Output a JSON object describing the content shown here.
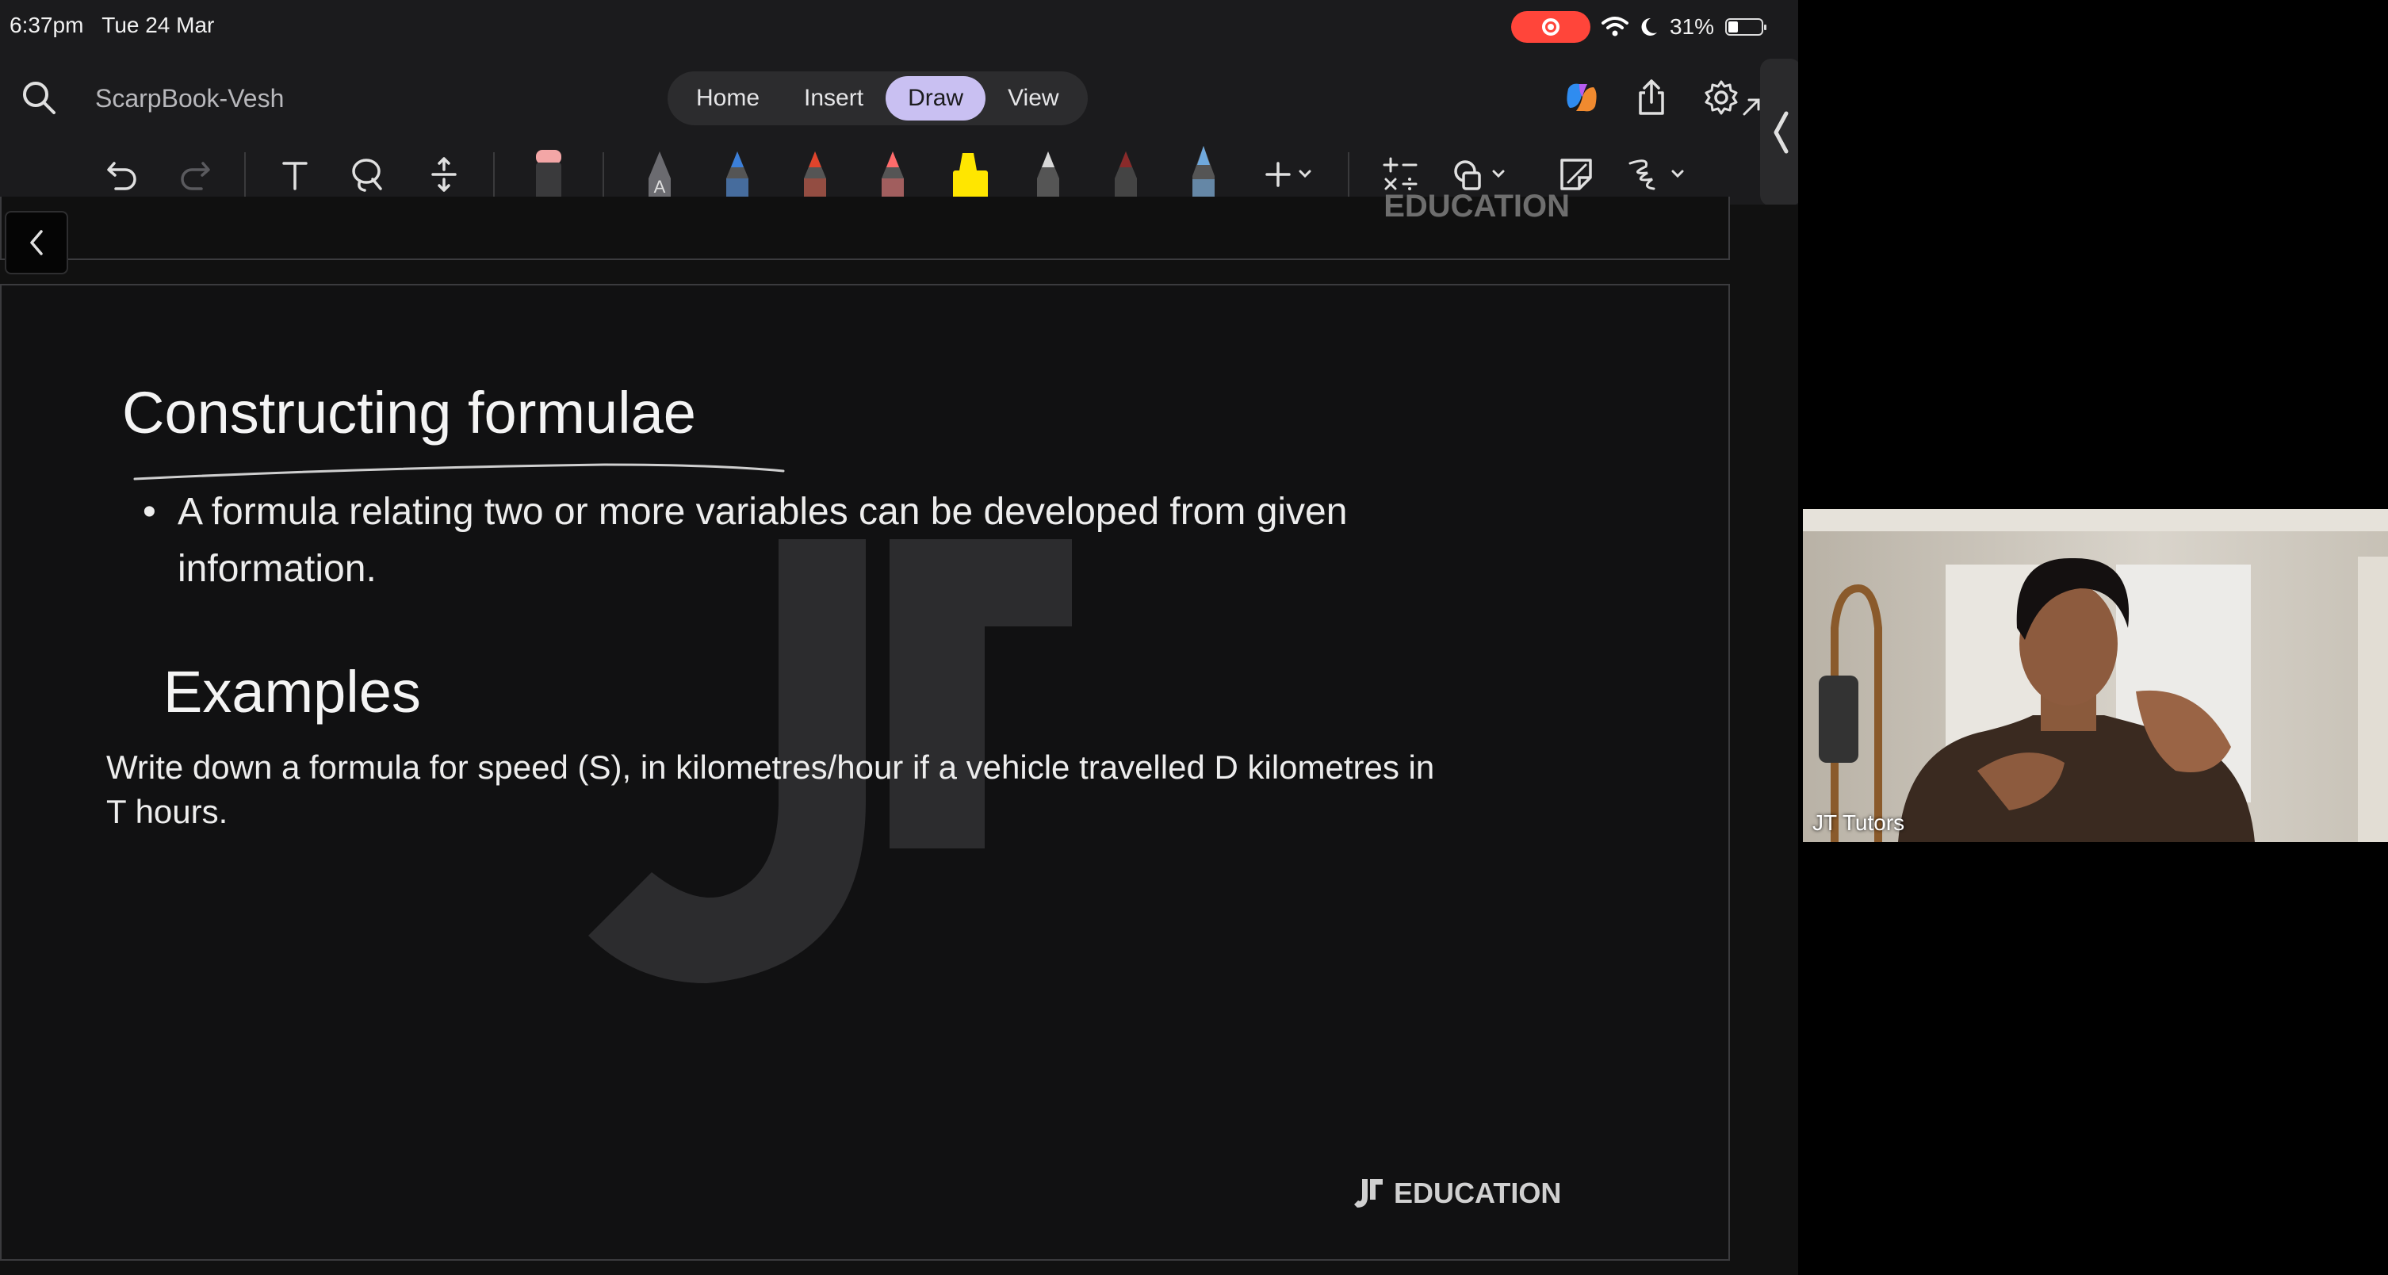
{
  "status_bar": {
    "time": "6:37pm",
    "date": "Tue 24 Mar",
    "battery": "31%"
  },
  "topbar": {
    "document_title": "ScarpBook-Vesh",
    "tabs": [
      {
        "label": "Home",
        "active": false
      },
      {
        "label": "Insert",
        "active": false
      },
      {
        "label": "Draw",
        "active": true
      },
      {
        "label": "View",
        "active": false
      }
    ]
  },
  "toolbar": {
    "tools": [
      "undo-icon",
      "redo-icon",
      "text-icon",
      "lasso-icon",
      "add-space-icon",
      "eraser-icon"
    ],
    "pens": [
      {
        "name": "pen-ink-to-text",
        "color": "#8e8e93",
        "label": "A"
      },
      {
        "name": "pen-blue",
        "color": "#3b7fd9"
      },
      {
        "name": "pen-red",
        "color": "#e0442c"
      },
      {
        "name": "pen-pink",
        "color": "#ff6b6b"
      },
      {
        "name": "highlighter-yellow",
        "color": "#ffe600"
      },
      {
        "name": "pen-white",
        "color": "#d8d8d8"
      },
      {
        "name": "pen-dark-red",
        "color": "#8a2a2a"
      },
      {
        "name": "pen-light-blue",
        "color": "#6fa8dc"
      }
    ]
  },
  "slide_prev": {
    "brand": "EDUCATION"
  },
  "slide": {
    "title": "Constructing formulae",
    "bullet": "A formula relating two or more variables can be developed from given information.",
    "examples_heading": "Examples",
    "question": "Write down a formula for speed (S), in kilometres/hour if a vehicle travelled D kilometres in T hours.",
    "brand": "EDUCATION"
  },
  "video": {
    "participant_name": "JT Tutors"
  },
  "colors": {
    "accent_tab": "#c9c0f2",
    "record": "#ff453a",
    "background": "#1b1b1d"
  }
}
